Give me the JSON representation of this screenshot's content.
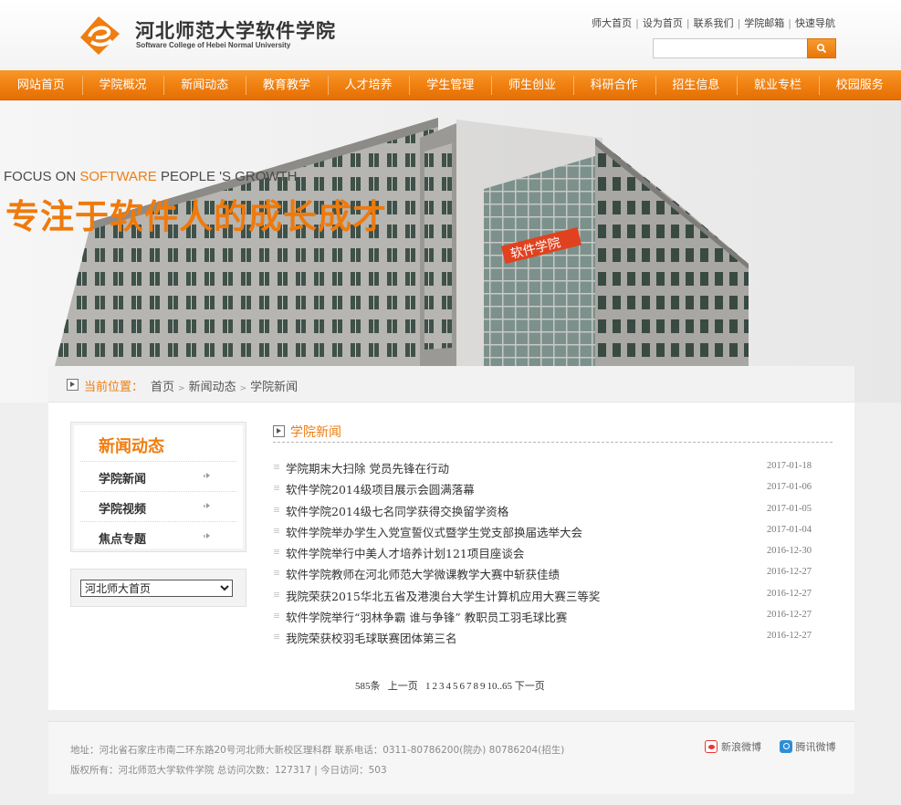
{
  "header": {
    "logo_cn": "河北师范大学软件学院",
    "logo_en": "Software College of Hebei Normal University",
    "top_links": [
      "师大首页",
      "设为首页",
      "联系我们",
      "学院邮箱",
      "快速导航"
    ],
    "search": {
      "placeholder": "",
      "value": "",
      "button_icon": "search-icon"
    }
  },
  "nav": {
    "items": [
      "网站首页",
      "学院概况",
      "新闻动态",
      "教育教学",
      "人才培养",
      "学生管理",
      "师生创业",
      "科研合作",
      "招生信息",
      "就业专栏",
      "校园服务"
    ]
  },
  "banner": {
    "en_pre": "FOCUS ON ",
    "en_hl": "SOFTWARE",
    "en_post": " PEOPLE 'S GROWTH",
    "cn": "专注于软件人的成长成才",
    "sign": "软件学院"
  },
  "breadcrumb": {
    "label": "当前位置：",
    "items": [
      "首页",
      "新闻动态",
      "学院新闻"
    ]
  },
  "sidebar": {
    "title": "新闻动态",
    "items": [
      "学院新闻",
      "学院视频",
      "焦点专题"
    ],
    "select": {
      "selected": "河北师大首页",
      "options": [
        "河北师大首页"
      ]
    }
  },
  "news": {
    "title": "学院新闻",
    "items": [
      {
        "title": "学院期末大扫除  党员先锋在行动",
        "date": "2017-01-18"
      },
      {
        "title": "软件学院2014级项目展示会圆满落幕",
        "date": "2017-01-06"
      },
      {
        "title": "软件学院2014级七名同学获得交换留学资格",
        "date": "2017-01-05"
      },
      {
        "title": "软件学院举办学生入党宣誓仪式暨学生党支部换届选举大会",
        "date": "2017-01-04"
      },
      {
        "title": "软件学院举行中美人才培养计划121项目座谈会",
        "date": "2016-12-30"
      },
      {
        "title": "软件学院教师在河北师范大学微课教学大赛中斩获佳绩",
        "date": "2016-12-27"
      },
      {
        "title": "我院荣获2015华北五省及港澳台大学生计算机应用大赛三等奖",
        "date": "2016-12-27"
      },
      {
        "title": "软件学院举行“羽林争霸 谁与争锋” 教职员工羽毛球比赛",
        "date": "2016-12-27"
      },
      {
        "title": "我院荣获校羽毛球联赛团体第三名",
        "date": "2016-12-27"
      }
    ]
  },
  "pager": {
    "total": "585条",
    "prev": "上一页",
    "pages": [
      "1",
      "2",
      "3",
      "4",
      "5",
      "6",
      "7",
      "8",
      "9",
      "10"
    ],
    "ellipsis": "..",
    "last": "65",
    "next": "下一页"
  },
  "footer": {
    "line1": "地址：河北省石家庄市南二环东路20号河北师大新校区理科群  联系电话：0311-80786200(院办) 80786204(招生)",
    "line2": "版权所有：河北师范大学软件学院      总访问次数：127317 | 今日访问：503",
    "social": [
      {
        "label": "新浪微博",
        "icon": "sina-weibo-icon"
      },
      {
        "label": "腾讯微博",
        "icon": "tencent-weibo-icon"
      }
    ]
  },
  "colors": {
    "accent": "#ef7d10",
    "nav_top": "#f8972a",
    "nav_bottom": "#e56f05"
  }
}
